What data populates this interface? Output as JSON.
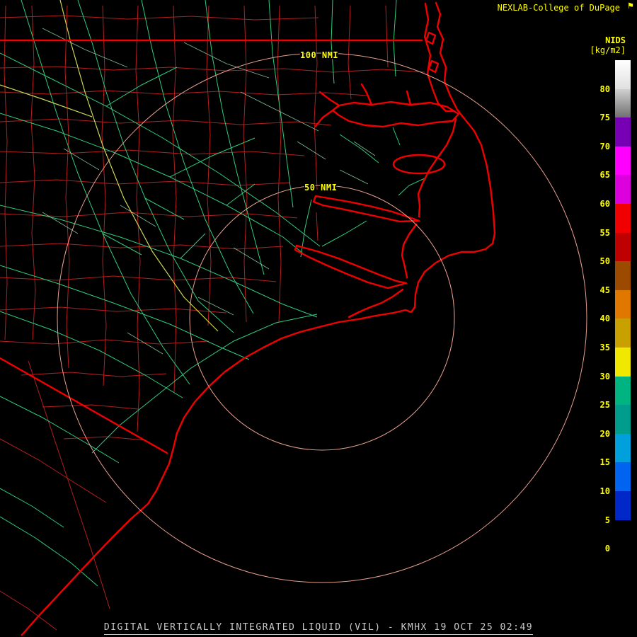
{
  "header": {
    "brand": "NEXLAB-College of DuPage",
    "logo_icon": "flag-icon"
  },
  "colorbar": {
    "title": "NIDS",
    "units": "[kg/m2]",
    "labels": [
      80,
      75,
      70,
      65,
      60,
      55,
      50,
      45,
      40,
      35,
      30,
      25,
      20,
      15,
      10,
      5,
      0
    ],
    "segments": [
      {
        "from": 85,
        "to": 80,
        "color": "#FFFFFF",
        "color2": "#E0E0E0"
      },
      {
        "from": 80,
        "to": 75,
        "color": "#D0D0D0",
        "color2": "#707070"
      },
      {
        "from": 75,
        "to": 70,
        "color": "#7800B4"
      },
      {
        "from": 70,
        "to": 65,
        "color": "#FF00FF"
      },
      {
        "from": 65,
        "to": 60,
        "color": "#DC00DC"
      },
      {
        "from": 60,
        "to": 55,
        "color": "#F00000"
      },
      {
        "from": 55,
        "to": 50,
        "color": "#BE0000"
      },
      {
        "from": 50,
        "to": 45,
        "color": "#9C4A00"
      },
      {
        "from": 45,
        "to": 40,
        "color": "#E07800"
      },
      {
        "from": 40,
        "to": 35,
        "color": "#C8A000"
      },
      {
        "from": 35,
        "to": 30,
        "color": "#F0E800"
      },
      {
        "from": 30,
        "to": 25,
        "color": "#00B482"
      },
      {
        "from": 25,
        "to": 20,
        "color": "#009C8C"
      },
      {
        "from": 20,
        "to": 15,
        "color": "#00A0DC"
      },
      {
        "from": 15,
        "to": 10,
        "color": "#0064F0"
      },
      {
        "from": 10,
        "to": 5,
        "color": "#0028C8"
      },
      {
        "from": 5,
        "to": 0,
        "color": "#000000"
      }
    ]
  },
  "rings": {
    "labels": [
      "100 NMI",
      "50 NMI"
    ],
    "color": "#E8A08C"
  },
  "map": {
    "station": "KMHX",
    "colors": {
      "coastline": "#F00000",
      "county_lines": "#C02020",
      "roads": "#2FCC7E",
      "roads_secondary": "#9BE8B8",
      "highway": "#CCD655",
      "ocean": "#000000",
      "text_yellow": "#FFFF00"
    }
  },
  "footer": {
    "caption": "DIGITAL VERTICALLY INTEGRATED LIQUID (VIL) - KMHX 19 OCT 25 02:49",
    "color": "#C8C8C8"
  }
}
